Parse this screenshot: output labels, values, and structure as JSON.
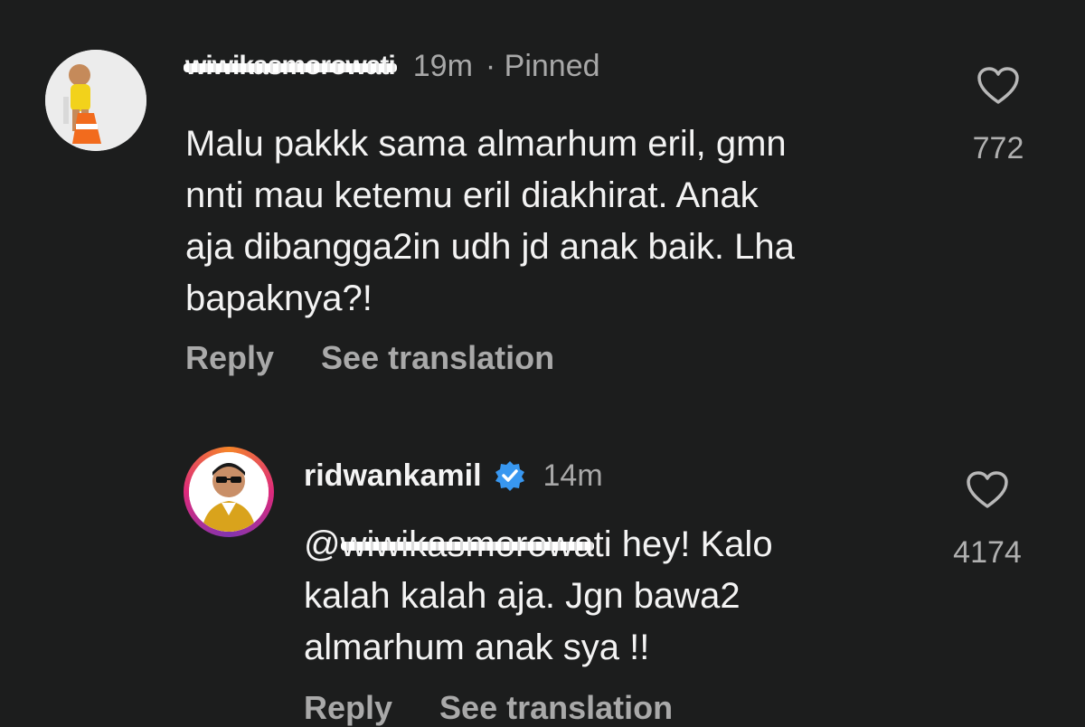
{
  "comments": [
    {
      "username_visible_suffix": "ti",
      "username_redacted_text": "wiwikasmorowa",
      "time": "19m",
      "pinned_label": "· Pinned",
      "text": "Malu pakkk sama almarhum eril, gmn\nnnti mau ketemu eril diakhirat. Anak\naja dibangga2in udh jd anak baik. Lha\nbapaknya?!",
      "actions": {
        "reply": "Reply",
        "translate": "See translation"
      },
      "likes": "772"
    },
    {
      "username": "ridwankamil",
      "verified": true,
      "time": "14m",
      "mention_at": "@",
      "mention_redacted_text": "wiwikasmorowa",
      "text_after_mention": "ti hey! Kalo",
      "text_rest": "kalah kalah aja. Jgn bawa2\nalmarhum anak sya !!",
      "actions": {
        "reply": "Reply",
        "translate": "See translation"
      },
      "likes": "4174"
    }
  ],
  "icons": {
    "like": "heart-outline-icon",
    "verified": "verified-badge-icon"
  },
  "colors": {
    "background": "#1c1d1d",
    "text": "#f3f3f3",
    "muted": "#a8a8a8",
    "verified": "#3897f0"
  }
}
